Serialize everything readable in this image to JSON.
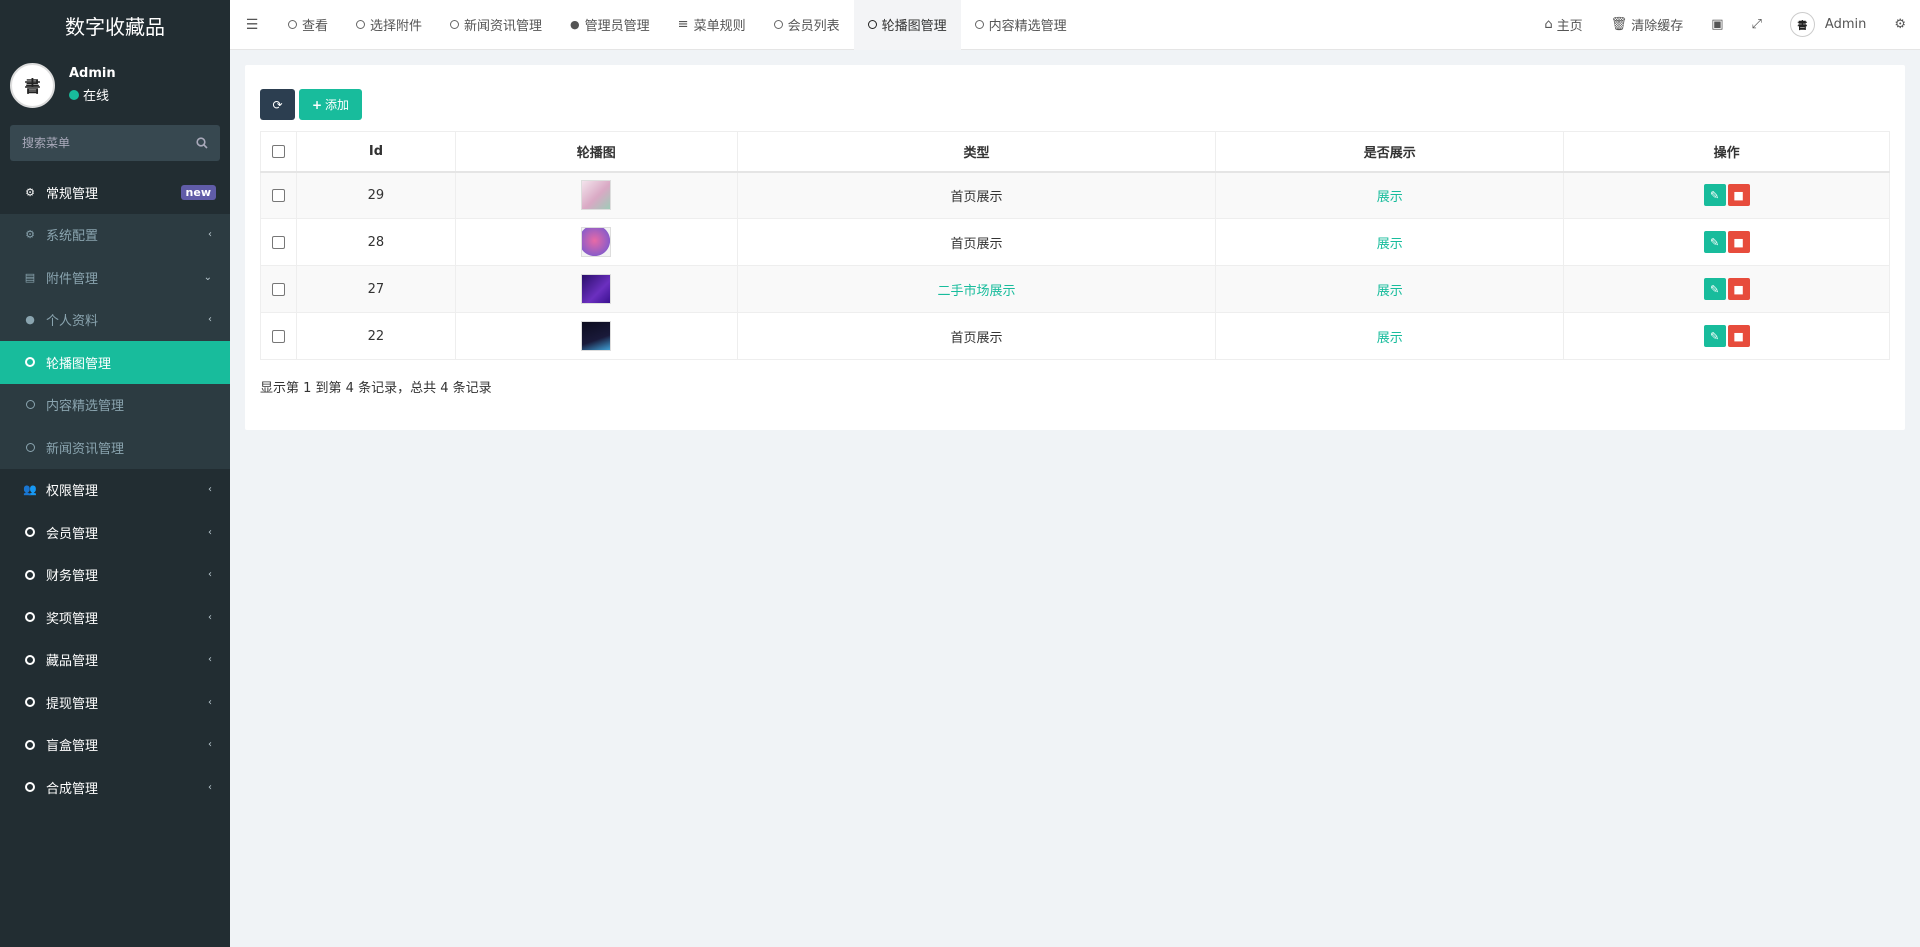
{
  "brand": {
    "title": "数字收藏品"
  },
  "user": {
    "name": "Admin",
    "status": "在线",
    "avatar_text": "書"
  },
  "search": {
    "placeholder": "搜索菜单"
  },
  "sidebar": {
    "items": [
      {
        "label": "常规管理",
        "badge": "new",
        "icon": "cogs-icon"
      },
      {
        "label": "系统配置",
        "icon": "gear-icon"
      },
      {
        "label": "附件管理",
        "icon": "file-image-icon"
      },
      {
        "label": "个人资料",
        "icon": "user-icon"
      },
      {
        "label": "轮播图管理",
        "icon": "circle-icon"
      },
      {
        "label": "内容精选管理",
        "icon": "circle-icon"
      },
      {
        "label": "新闻资讯管理",
        "icon": "circle-icon"
      },
      {
        "label": "权限管理",
        "icon": "users-icon"
      },
      {
        "label": "会员管理",
        "icon": "circle-icon"
      },
      {
        "label": "财务管理",
        "icon": "circle-icon"
      },
      {
        "label": "奖项管理",
        "icon": "circle-icon"
      },
      {
        "label": "藏品管理",
        "icon": "circle-icon"
      },
      {
        "label": "提现管理",
        "icon": "circle-icon"
      },
      {
        "label": "盲盒管理",
        "icon": "circle-icon"
      },
      {
        "label": "合成管理",
        "icon": "circle-icon"
      }
    ]
  },
  "tabs": [
    {
      "label": "查看"
    },
    {
      "label": "选择附件"
    },
    {
      "label": "新闻资讯管理"
    },
    {
      "label": "管理员管理"
    },
    {
      "label": "菜单规则"
    },
    {
      "label": "会员列表"
    },
    {
      "label": "轮播图管理"
    },
    {
      "label": "内容精选管理"
    }
  ],
  "topright": {
    "home": "主页",
    "clear_cache": "清除缓存",
    "admin": "Admin"
  },
  "toolbar": {
    "add_label": "添加"
  },
  "table": {
    "headers": [
      "Id",
      "轮播图",
      "类型",
      "是否展示",
      "操作"
    ],
    "rows": [
      {
        "id": "29",
        "type": "首页展示",
        "show": "展示",
        "thumb_color": "#e8c9d8"
      },
      {
        "id": "28",
        "type": "首页展示",
        "show": "展示",
        "thumb_color": "#c65a9a"
      },
      {
        "id": "27",
        "type": "二手市场展示",
        "show": "展示",
        "thumb_color": "#4a1a8c"
      },
      {
        "id": "22",
        "type": "首页展示",
        "show": "展示",
        "thumb_color": "#14142a"
      }
    ]
  },
  "pagination": {
    "summary": "显示第 1 到第 4 条记录，总共 4 条记录"
  },
  "colors": {
    "accent": "#18bc9c",
    "sidebar_bg": "#222d32",
    "danger": "#e74c3c",
    "dark_btn": "#2c3e50"
  }
}
